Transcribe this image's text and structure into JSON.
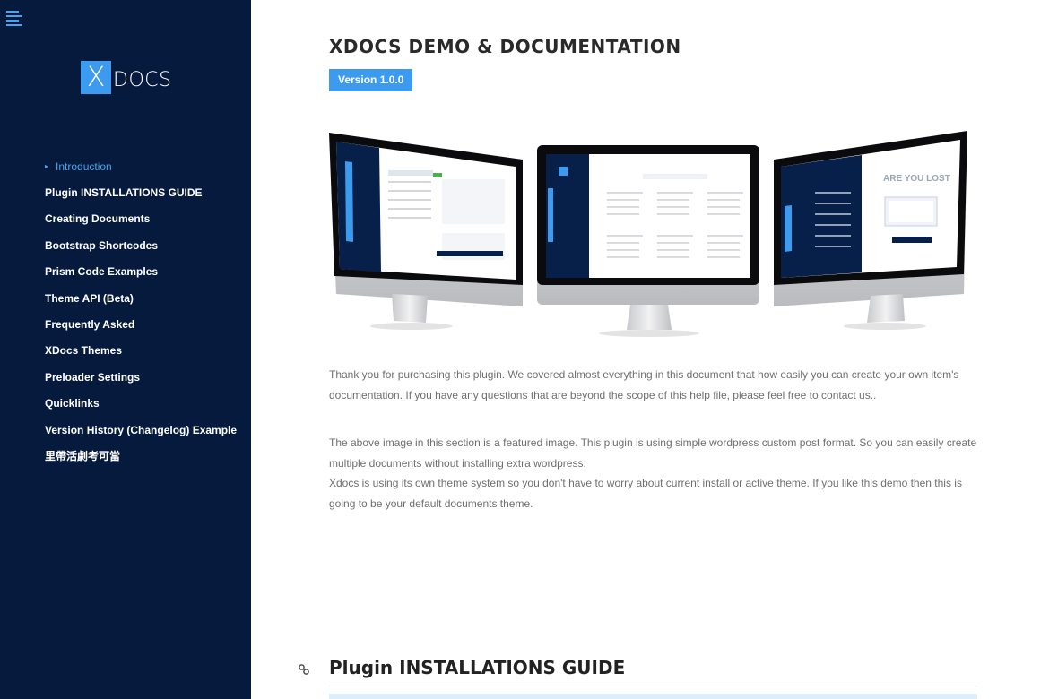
{
  "sidebar": {
    "logo_mark": "X",
    "logo_text": "DOCS",
    "items": [
      {
        "label": "Introduction",
        "active": true
      },
      {
        "label": "Plugin INSTALLATIONS GUIDE"
      },
      {
        "label": "Creating Documents"
      },
      {
        "label": "Bootstrap Shortcodes"
      },
      {
        "label": "Prism Code Examples"
      },
      {
        "label": "Theme API (Beta)"
      },
      {
        "label": "Frequently Asked"
      },
      {
        "label": "XDocs Themes"
      },
      {
        "label": "Preloader Settings"
      },
      {
        "label": "Quicklinks"
      },
      {
        "label": "Version History (Changelog) Example"
      },
      {
        "label": "里帶活劇考可當"
      }
    ]
  },
  "main": {
    "title": "XDOCS DEMO & DOCUMENTATION",
    "version": "Version 1.0.0",
    "hero_screen_text": "ARE YOU LOST",
    "paragraphs": [
      "Thank you for purchasing this plugin. We covered almost everything in this document that how easily you can create your own item's documentation. If you have any questions that are beyond the scope of this help file, please feel free to contact us..",
      "The above image in this section is a featured image. This plugin is using simple wordpress custom post format. So you can easily create multiple documents without installing extra wordpress.",
      "Xdocs is using its own theme system so you don't have to worry about current install or active theme. If you like this demo then this is going to be your default documents theme."
    ],
    "section_title": "Plugin INSTALLATIONS GUIDE"
  },
  "colors": {
    "sidebar_bg": "#051a3c",
    "accent": "#3d9bef",
    "text_muted": "#6f6f6f"
  },
  "icons": {
    "menu": "hamburger-menu-icon",
    "section_anchor": "link-icon",
    "active_caret": "caret-right-icon"
  }
}
